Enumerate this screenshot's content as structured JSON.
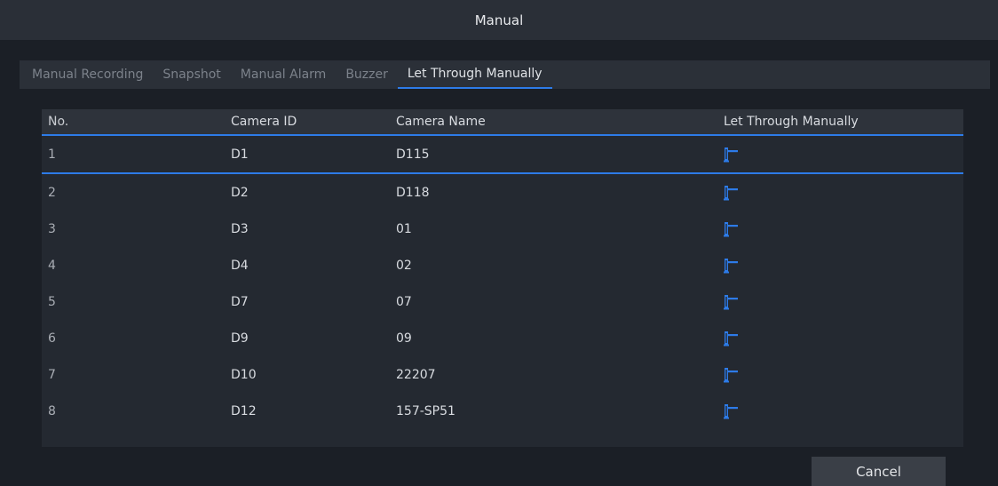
{
  "window": {
    "title": "Manual"
  },
  "tabs": [
    {
      "label": "Manual Recording",
      "active": false
    },
    {
      "label": "Snapshot",
      "active": false
    },
    {
      "label": "Manual Alarm",
      "active": false
    },
    {
      "label": "Buzzer",
      "active": false
    },
    {
      "label": "Let Through Manually",
      "active": true
    }
  ],
  "table": {
    "columns": [
      "No.",
      "Camera ID",
      "Camera Name",
      "Let Through Manually"
    ],
    "rows": [
      {
        "no": "1",
        "camera_id": "D1",
        "camera_name": "D115",
        "action_icon": "barrier-gate-icon"
      },
      {
        "no": "2",
        "camera_id": "D2",
        "camera_name": "D118",
        "action_icon": "barrier-gate-icon"
      },
      {
        "no": "3",
        "camera_id": "D3",
        "camera_name": "01",
        "action_icon": "barrier-gate-icon"
      },
      {
        "no": "4",
        "camera_id": "D4",
        "camera_name": "02",
        "action_icon": "barrier-gate-icon"
      },
      {
        "no": "5",
        "camera_id": "D7",
        "camera_name": "07",
        "action_icon": "barrier-gate-icon"
      },
      {
        "no": "6",
        "camera_id": "D9",
        "camera_name": "09",
        "action_icon": "barrier-gate-icon"
      },
      {
        "no": "7",
        "camera_id": "D10",
        "camera_name": "22207",
        "action_icon": "barrier-gate-icon"
      },
      {
        "no": "8",
        "camera_id": "D12",
        "camera_name": "157-SP51",
        "action_icon": "barrier-gate-icon"
      }
    ],
    "selected_row": 1
  },
  "footer": {
    "cancel_label": "Cancel"
  },
  "colors": {
    "accent": "#2d7be8",
    "background": "#1b1f26",
    "panel": "#242931"
  }
}
